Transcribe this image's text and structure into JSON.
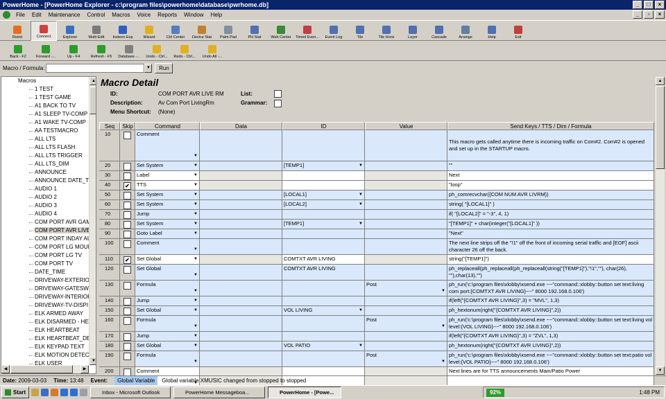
{
  "window": {
    "app_title": "PowerHome",
    "inner_title": "PowerHome Explorer - [Macro Detail]",
    "doc_title": "PowerHome - [PowerHome Explorer - c:\\program files\\powerhome\\database\\pwrhome.db]"
  },
  "menu": [
    "File",
    "Edit",
    "Maintenance",
    "Control",
    "Macros",
    "Voice",
    "Reports",
    "Window",
    "Help"
  ],
  "toolbar1": [
    "Reinit",
    "Connect",
    "Explorer",
    "Multi-Edit",
    "Insteon Exp",
    "Wizard",
    "Ctrl Center",
    "Device Stat",
    "Palm Pad",
    "PH Stat",
    "Web Center",
    "Timed Even...",
    "Event Log",
    "Tile",
    "Tile Horiz",
    "Layer",
    "Cascade",
    "Arrange",
    "Help",
    "Exit"
  ],
  "toolbar2": [
    "Back - F2",
    "Forward -...",
    "Up - F4",
    "Refresh - F5",
    "Database -...",
    "Undo - Ctrl...",
    "Redo - Ctrl...",
    "Undo All -..."
  ],
  "formula": {
    "label": "Macro / Formula:",
    "run_label": "Run"
  },
  "tree": {
    "root": "Macros",
    "items": [
      "1 TEST",
      "1 TEST GAME",
      "A1 BACK TO TV",
      "A1 SLEEP TV-COMP",
      "A1 WAKE TV-COMP",
      "AA TESTMACRO",
      "ALL LTS",
      "ALL LTS FLASH",
      "ALL LTS TRIGGER",
      "ALL LTS_DIM",
      "ANNOUNCE",
      "ANNOUNCE DATE_TI",
      "AUDIO 1",
      "AUDIO 2",
      "AUDIO 3",
      "AUDIO 4",
      "COM PORT AVR GAM",
      "COM PORT AVR LIVE",
      "COM PORT INDAY AU",
      "COM PORT LG MOUN",
      "COM PORT LG TV",
      "COM PORT TV",
      "DATE_TIME",
      "DRIVEWAY-EXTERIO",
      "DRIVEWAY-GATESW",
      "DRIVEWAY-INTERIOF",
      "DRIVEWAY-TV-DISPI",
      "ELK ARMED AWAY",
      "ELK DISARMED - HEL",
      "ELK HEARTBEAT",
      "ELK HEARTBEAT_DE",
      "ELK KEYPAD TEXT",
      "ELK MOTION DETECT",
      "ELK USER"
    ]
  },
  "detail": {
    "title": "Macro Detail",
    "id_label": "ID:",
    "id_value": "COM PORT AVR LIVE RM",
    "desc_label": "Description:",
    "desc_value": "Av Com Port LivingRm",
    "shortcut_label": "Menu Shortcut:",
    "shortcut_value": "(None)",
    "list_label": "List:",
    "grammar_label": "Grammar:"
  },
  "columns": [
    "Seq",
    "Skip",
    "Command",
    "Data",
    "ID",
    "Value",
    "Send Keys / TTS / Dim / Formula"
  ],
  "rows": [
    {
      "seq": "10",
      "skip": false,
      "cmd": "Comment",
      "data": "",
      "id": "",
      "val": "",
      "send": "This macro gets called anytime there is incoming traffic on Com#2.  Com#2 is opened and set up in the STARTUP macro.",
      "h": 44,
      "blue": true,
      "dd_id": false,
      "dd_val": false
    },
    {
      "seq": "20",
      "skip": false,
      "cmd": "Set System",
      "data": "",
      "id": "[TEMP1]",
      "val": "",
      "send": "\"\"",
      "h": 13,
      "blue": true,
      "dd_id": true,
      "dd_val": false
    },
    {
      "seq": "30",
      "skip": false,
      "cmd": "Label",
      "data": "",
      "id": "",
      "val": "",
      "send": "Next",
      "h": 13,
      "blue": false,
      "dd_id": false,
      "dd_val": false
    },
    {
      "seq": "40",
      "skip": true,
      "cmd": "TTS",
      "data": "",
      "id": "",
      "val": "",
      "send": "\"loop\"",
      "h": 13,
      "blue": false,
      "dd_id": false,
      "dd_val": false
    },
    {
      "seq": "50",
      "skip": false,
      "cmd": "Set System",
      "data": "",
      "id": "[LOCAL1]",
      "val": "",
      "send": "ph_comrecvchar({COM NUM AVR LIVRM})",
      "h": 13,
      "blue": true,
      "dd_id": true,
      "dd_val": false
    },
    {
      "seq": "60",
      "skip": false,
      "cmd": "Set System",
      "data": "",
      "id": "[LOCAL2]",
      "val": "",
      "send": "string( \"[LOCAL1]\" )",
      "h": 13,
      "blue": true,
      "dd_id": true,
      "dd_val": false
    },
    {
      "seq": "70",
      "skip": false,
      "cmd": "Jump",
      "data": "",
      "id": "",
      "val": "",
      "send": "if( \"[LOCAL2]\" = \"-3\", 4, 1)",
      "h": 13,
      "blue": true,
      "dd_id": false,
      "dd_val": false
    },
    {
      "seq": "80",
      "skip": false,
      "cmd": "Set System",
      "data": "",
      "id": "[TEMP1]",
      "val": "",
      "send": "\"[TEMP1]\" + char(integer(\"[LOCAL1]\" ))",
      "h": 13,
      "blue": true,
      "dd_id": true,
      "dd_val": false
    },
    {
      "seq": "90",
      "skip": false,
      "cmd": "Goto Label",
      "data": "",
      "id": "",
      "val": "",
      "send": "\"Next\"",
      "h": 13,
      "blue": true,
      "dd_id": false,
      "dd_val": false
    },
    {
      "seq": "100",
      "skip": false,
      "cmd": "Comment",
      "data": "",
      "id": "",
      "val": "",
      "send": "The next line strips off the \"!1\" off the front of incoming serial traffic and [EOF] ascii character 26 off the back.",
      "h": 22,
      "blue": true,
      "dd_id": false,
      "dd_val": false
    },
    {
      "seq": "110",
      "skip": true,
      "cmd": "Set Global",
      "data": "",
      "id": "COMTXT AVR LIVING",
      "val": "",
      "send": "string(\"[TEMP1]\")",
      "h": 13,
      "blue": false,
      "dd_id": false,
      "dd_val": false
    },
    {
      "seq": "120",
      "skip": false,
      "cmd": "Set Global",
      "data": "",
      "id": "COMTXT AVR LIVING",
      "val": "",
      "send": "ph_replaceall(ph_replaceall(ph_replaceall(string(\"[TEMP1]\"),\"!1\",\"\"), char(26), \"\"),char(13),\"\")",
      "h": 22,
      "blue": true,
      "dd_id": false,
      "dd_val": false
    },
    {
      "seq": "130",
      "skip": false,
      "cmd": "Formula",
      "data": "",
      "id": "",
      "val": "Post",
      "send": "ph_run('c:\\program files\\xlobby\\xsend.exe ~~\"command::xlobby::button set text:living com port:{COMTXT AVR LIVING}~~\" 8000 192.168.0.106')",
      "h": 22,
      "blue": true,
      "dd_id": false,
      "dd_val": true
    },
    {
      "seq": "140",
      "skip": false,
      "cmd": "Jump",
      "data": "",
      "id": "",
      "val": "",
      "send": "if(left(\"{COMTXT AVR LIVING}\",3) = \"MVL\", 1,3)",
      "h": 13,
      "blue": true,
      "dd_id": false,
      "dd_val": false
    },
    {
      "seq": "150",
      "skip": false,
      "cmd": "Set Global",
      "data": "",
      "id": "VOL LIVING",
      "val": "",
      "send": "ph_hextonum(right(\"{COMTXT AVR LIVING}\",2))",
      "h": 13,
      "blue": true,
      "dd_id": true,
      "dd_val": false
    },
    {
      "seq": "160",
      "skip": false,
      "cmd": "Formula",
      "data": "",
      "id": "",
      "val": "Post",
      "send": "ph_run('c:\\program files\\xlobby\\xsend.exe ~~\"command::xlobby::button set text:living vol level:{VOL LIVING}~~\" 8000 192.168.0.106')",
      "h": 22,
      "blue": true,
      "dd_id": false,
      "dd_val": true
    },
    {
      "seq": "170",
      "skip": false,
      "cmd": "Jump",
      "data": "",
      "id": "",
      "val": "",
      "send": "if(left(\"{COMTXT AVR LIVING}\",3) = \"ZVL\", 1,3)",
      "h": 13,
      "blue": true,
      "dd_id": false,
      "dd_val": false
    },
    {
      "seq": "180",
      "skip": false,
      "cmd": "Set Global",
      "data": "",
      "id": "VOL PATIO",
      "val": "",
      "send": "ph_hextonum(right(\"{COMTXT AVR LIVING}\",2))",
      "h": 13,
      "blue": true,
      "dd_id": true,
      "dd_val": false
    },
    {
      "seq": "190",
      "skip": false,
      "cmd": "Formula",
      "data": "",
      "id": "",
      "val": "Post",
      "send": "ph_run('c:\\program files\\xlobby\\xsend.exe ~~\"command::xlobby::button set text:patio vol level:{VOL PATIO}~~\" 8000 192.168.0.106')",
      "h": 22,
      "blue": true,
      "dd_id": false,
      "dd_val": true
    },
    {
      "seq": "200",
      "skip": false,
      "cmd": "Comment",
      "data": "",
      "id": "",
      "val": "",
      "send": "Next lines are for TTS announcements Main/Patio Power",
      "h": 30,
      "blue": false,
      "dd_id": false,
      "dd_val": false
    }
  ],
  "status": {
    "date_label": "Date:",
    "date": "2009-03-03",
    "time_label": "Time:",
    "time": "13:48",
    "event_label": "Event:",
    "event": "Global Variable",
    "message": "Global variable XMUSIC changed from stopped to stopped"
  },
  "taskbar": {
    "start": "Start",
    "tasks": [
      "Inbox - Microsoft Outlook",
      "PowerHome Messageboa...",
      "PowerHome  - [Powe..."
    ],
    "battery": "92%",
    "clock": "1:48 PM"
  },
  "colors": {
    "titlebar": "#0a246a",
    "row_highlight": "#d9e8fb",
    "chrome": "#d4d0c8"
  }
}
